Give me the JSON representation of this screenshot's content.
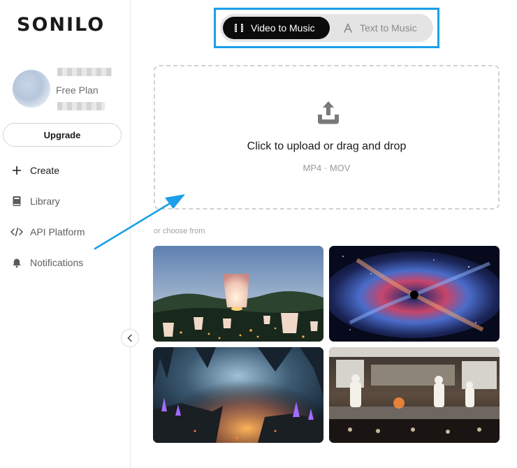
{
  "app": {
    "logo": "SONILO"
  },
  "user": {
    "plan": "Free Plan"
  },
  "sidebar": {
    "upgrade_label": "Upgrade",
    "items": [
      {
        "label": "Create",
        "icon": "plus-icon"
      },
      {
        "label": "Library",
        "icon": "book-icon"
      },
      {
        "label": "API Platform",
        "icon": "code-icon"
      },
      {
        "label": "Notifications",
        "icon": "bell-icon"
      }
    ]
  },
  "mode_toggle": {
    "options": [
      {
        "label": "Video to Music",
        "icon": "film-icon",
        "selected": true
      },
      {
        "label": "Text to Music",
        "icon": "text-icon",
        "selected": false
      }
    ]
  },
  "upload": {
    "title": "Click to upload or drag and drop",
    "formats": "MP4 · MOV"
  },
  "samples": {
    "heading": "or choose from",
    "items": [
      {
        "subject": "sky lanterns"
      },
      {
        "subject": "cosmic nebula"
      },
      {
        "subject": "crystal cave"
      },
      {
        "subject": "restaurant kitchen"
      }
    ]
  },
  "colors": {
    "highlight": "#1a9fe8",
    "toggle_active": "#0b0b0b",
    "toggle_track": "#e4e4e4"
  }
}
